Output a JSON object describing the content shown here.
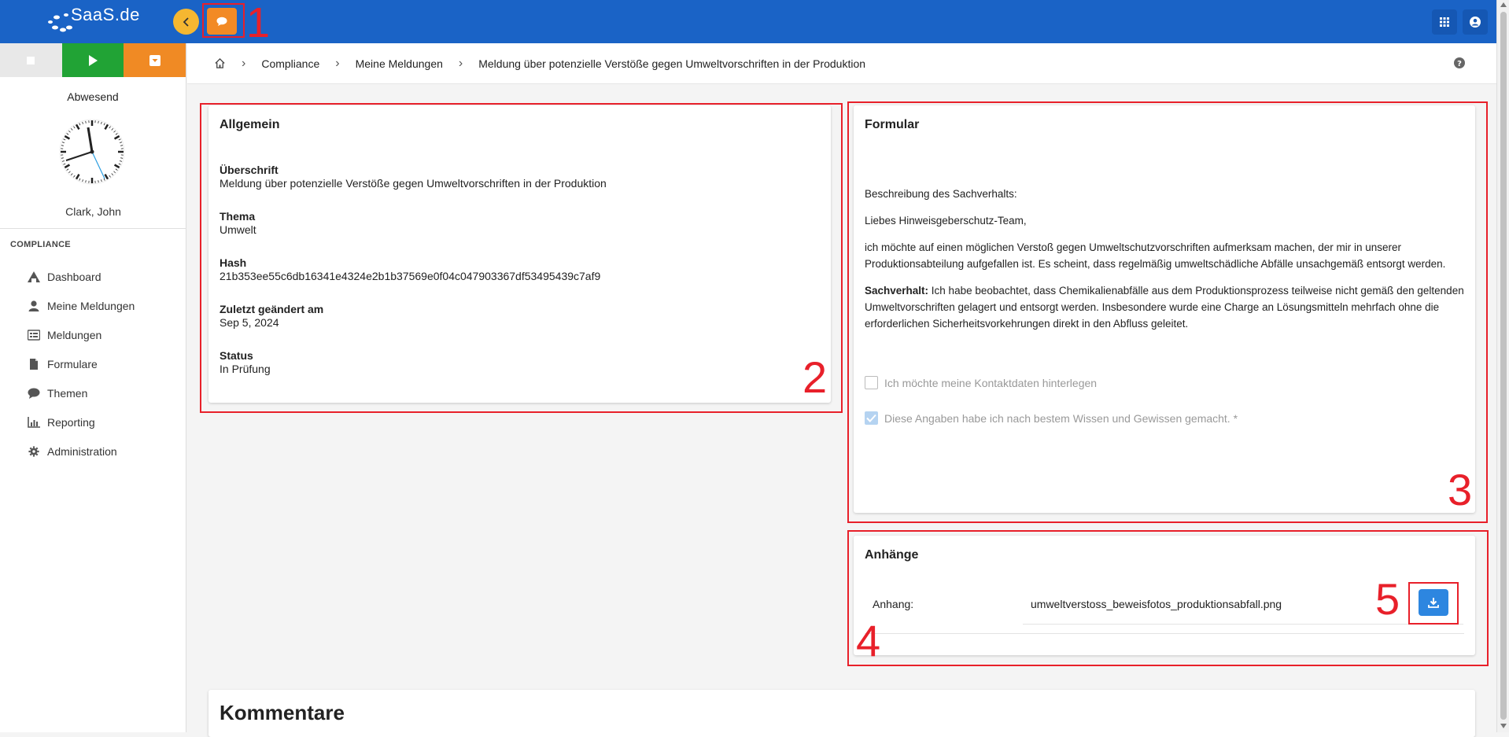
{
  "app": {
    "logo_text": "SaaS.de"
  },
  "colors": {
    "topbar": "#1a63c6",
    "accent_orange": "#f28a25",
    "accent_yellow": "#f5b731",
    "play_green": "#21a335",
    "annotation_red": "#e8202a"
  },
  "sidebar": {
    "presence": "Abwesend",
    "user": "Clark, John",
    "section_heading": "COMPLIANCE",
    "items": [
      {
        "label": "Dashboard",
        "icon": "dashboard-icon"
      },
      {
        "label": "Meine Meldungen",
        "icon": "person-icon"
      },
      {
        "label": "Meldungen",
        "icon": "list-icon"
      },
      {
        "label": "Formulare",
        "icon": "document-icon"
      },
      {
        "label": "Themen",
        "icon": "chat-icon"
      },
      {
        "label": "Reporting",
        "icon": "bar-chart-icon"
      },
      {
        "label": "Administration",
        "icon": "gear-icon"
      }
    ]
  },
  "breadcrumb": {
    "items": [
      "Compliance",
      "Meine Meldungen",
      "Meldung über potenzielle Verstöße gegen Umweltvorschriften in der Produktion"
    ]
  },
  "general": {
    "title": "Allgemein",
    "fields": [
      {
        "label": "Überschrift",
        "value": "Meldung über potenzielle Verstöße gegen Umweltvorschriften in der Produktion"
      },
      {
        "label": "Thema",
        "value": "Umwelt"
      },
      {
        "label": "Hash",
        "value": "21b353ee55c6db16341e4324e2b1b37569e0f04c047903367df53495439c7af9"
      },
      {
        "label": "Zuletzt geändert am",
        "value": "Sep 5, 2024"
      },
      {
        "label": "Status",
        "value": "In Prüfung"
      }
    ]
  },
  "form": {
    "title": "Formular",
    "description_heading": "Beschreibung des Sachverhalts:",
    "greeting": "Liebes Hinweisgeberschutz-Team,",
    "paragraph1": "ich möchte auf einen möglichen Verstoß gegen Umweltschutzvorschriften aufmerksam machen, der mir in unserer Produktionsabteilung aufgefallen ist. Es scheint, dass regelmäßig umweltschädliche Abfälle unsachgemäß entsorgt werden.",
    "fact_label": "Sachverhalt:",
    "fact_text": " Ich habe beobachtet, dass Chemikalienabfälle aus dem Produktionsprozess teilweise nicht gemäß den geltenden Umweltvorschriften gelagert und entsorgt werden. Insbesondere wurde eine Charge an Lösungsmitteln mehrfach ohne die erforderlichen Sicherheitsvorkehrungen direkt in den Abfluss geleitet.",
    "checkbox_contact": {
      "label": "Ich möchte meine Kontaktdaten hinterlegen",
      "checked": false
    },
    "checkbox_truth": {
      "label": "Diese Angaben habe ich nach bestem Wissen und Gewissen gemacht. *",
      "checked": true
    }
  },
  "attachments": {
    "title": "Anhänge",
    "label": "Anhang:",
    "filename": "umweltverstoss_beweisfotos_produktionsabfall.png"
  },
  "comments": {
    "title": "Kommentare"
  },
  "annotations": [
    "1",
    "2",
    "3",
    "4",
    "5"
  ]
}
